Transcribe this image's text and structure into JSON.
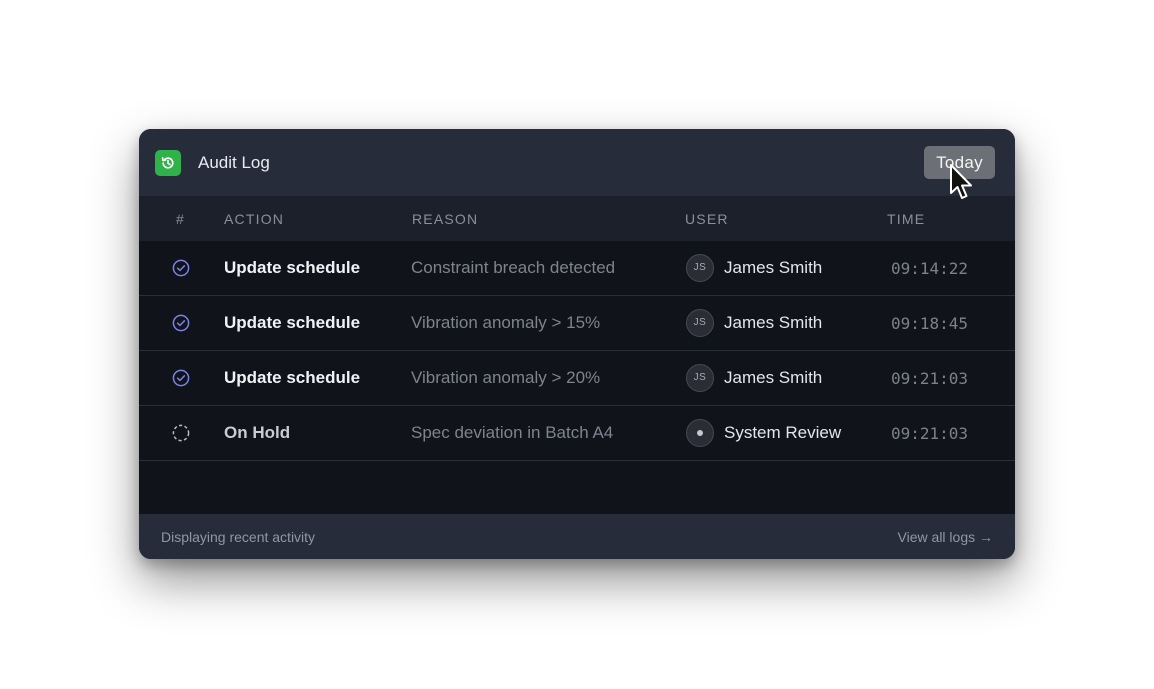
{
  "header": {
    "title": "Audit Log",
    "logo_icon": "history-icon",
    "date_filter_label": "Today"
  },
  "table": {
    "columns": [
      "#",
      "ACTION",
      "REASON",
      "USER",
      "TIME"
    ],
    "rows": [
      {
        "status": "completed",
        "status_icon": "check-circle-icon",
        "action": "Update schedule",
        "reason": "Constraint breach detected",
        "user_initials": "JS",
        "user": "James Smith",
        "time": "09:14:22"
      },
      {
        "status": "completed",
        "status_icon": "check-circle-icon",
        "action": "Update schedule",
        "reason": "Vibration anomaly > 15%",
        "user_initials": "JS",
        "user": "James Smith",
        "time": "09:18:45"
      },
      {
        "status": "completed",
        "status_icon": "check-circle-icon",
        "action": "Update schedule",
        "reason": "Vibration anomaly > 20%",
        "user_initials": "JS",
        "user": "James Smith",
        "time": "09:21:03"
      },
      {
        "status": "pending",
        "status_icon": "dashed-circle-icon",
        "action": "On Hold",
        "reason": "Spec deviation in Batch A4",
        "user_initials": "",
        "user": "System Review",
        "time": "09:21:03"
      }
    ]
  },
  "footer": {
    "status_text": "Displaying recent activity",
    "link_label": "View all logs →"
  },
  "colors": {
    "card_bg": "#11131b",
    "header_bg": "#272c3b",
    "brand_green": "#2fb24a",
    "check_accent": "#7b83e6",
    "button_bg": "#6c6f75"
  }
}
